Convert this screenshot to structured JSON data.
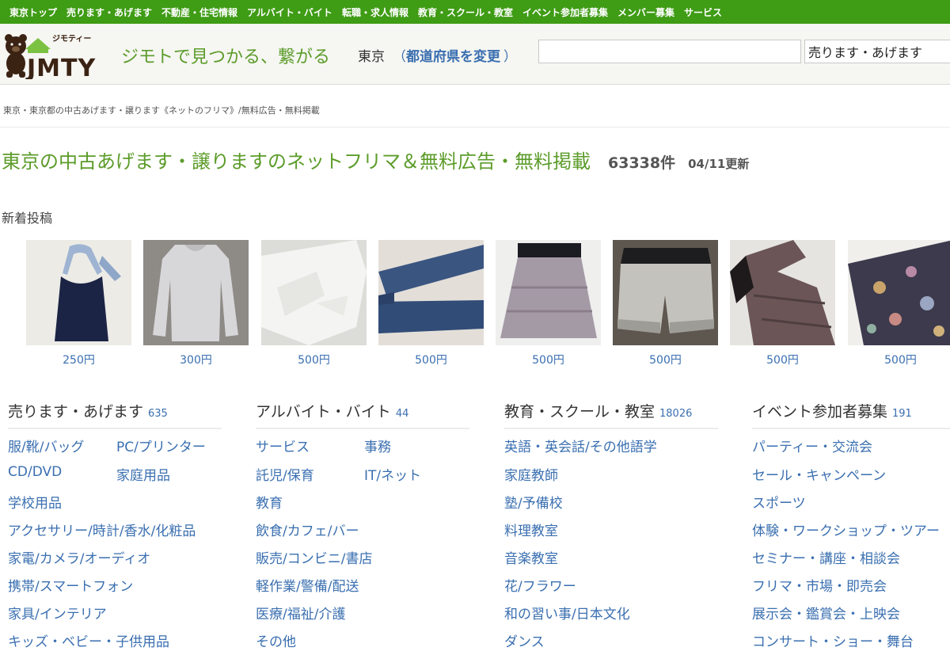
{
  "topnav": {
    "items": [
      "東京トップ",
      "売ります・あげます",
      "不動産・住宅情報",
      "アルバイト・バイト",
      "転職・求人情報",
      "教育・スクール・教室",
      "イベント参加者募集",
      "メンバー募集",
      "サービス"
    ]
  },
  "header": {
    "logo_text": "JMTY",
    "logo_sub": "ジモティー",
    "tagline": "ジモトで見つかる、繋がる",
    "city": "東京",
    "paren_open": "（",
    "change_pref": "都道府県を変更",
    "paren_close": "）",
    "search_value": "",
    "category_selected": "売ります・あげます"
  },
  "breadcrumb": "東京・東京都の中古あげます・譲ります《ネットのフリマ》/無料広告・無料掲載",
  "page": {
    "title": "東京の中古あげます・譲りますのネットフリマ＆無料広告・無料掲載",
    "count": "63338件",
    "updated": "04/11更新",
    "new_posts_label": "新着投稿"
  },
  "thumbnails": [
    {
      "item": "navy-halter-top",
      "price": "250円"
    },
    {
      "item": "gray-long-sleeve-top",
      "price": "300円"
    },
    {
      "item": "white-cardigan",
      "price": "500円"
    },
    {
      "item": "denim-jeans",
      "price": "500円"
    },
    {
      "item": "floral-mini-skirt",
      "price": "500円"
    },
    {
      "item": "denim-shorts",
      "price": "500円"
    },
    {
      "item": "patterned-dress",
      "price": "500円"
    },
    {
      "item": "floral-fabric",
      "price": "500円"
    }
  ],
  "columns": [
    {
      "title": "売ります・あげます",
      "count": "635",
      "links": [
        "服/靴/バッグ",
        "PC/プリンター",
        "CD/DVD",
        "家庭用品",
        "学校用品",
        "アクセサリー/時計/香水/化粧品",
        "家電/カメラ/オーディオ",
        "携帯/スマートフォン",
        "家具/インテリア",
        "キッズ・ベビー・子供用品"
      ]
    },
    {
      "title": "アルバイト・バイト",
      "count": "44",
      "links": [
        "サービス",
        "事務",
        "託児/保育",
        "IT/ネット",
        "教育",
        "飲食/カフェ/バー",
        "販売/コンビニ/書店",
        "軽作業/警備/配送",
        "医療/福祉/介護",
        "その他"
      ]
    },
    {
      "title": "教育・スクール・教室",
      "count": "18026",
      "links": [
        "英語・英会話/その他語学",
        "家庭教師",
        "塾/予備校",
        "料理教室",
        "音楽教室",
        "花/フラワー",
        "和の習い事/日本文化",
        "ダンス"
      ]
    },
    {
      "title": "イベント参加者募集",
      "count": "191",
      "links": [
        "パーティー・交流会",
        "セール・キャンペーン",
        "スポーツ",
        "体験・ワークショップ・ツアー",
        "セミナー・講座・相談会",
        "フリマ・市場・即売会",
        "展示会・鑑賞会・上映会",
        "コンサート・ショー・舞台"
      ]
    }
  ],
  "colors": {
    "nav_green": "#3f9c15",
    "title_green": "#5c9c2a",
    "link_blue": "#3a6fb0"
  }
}
